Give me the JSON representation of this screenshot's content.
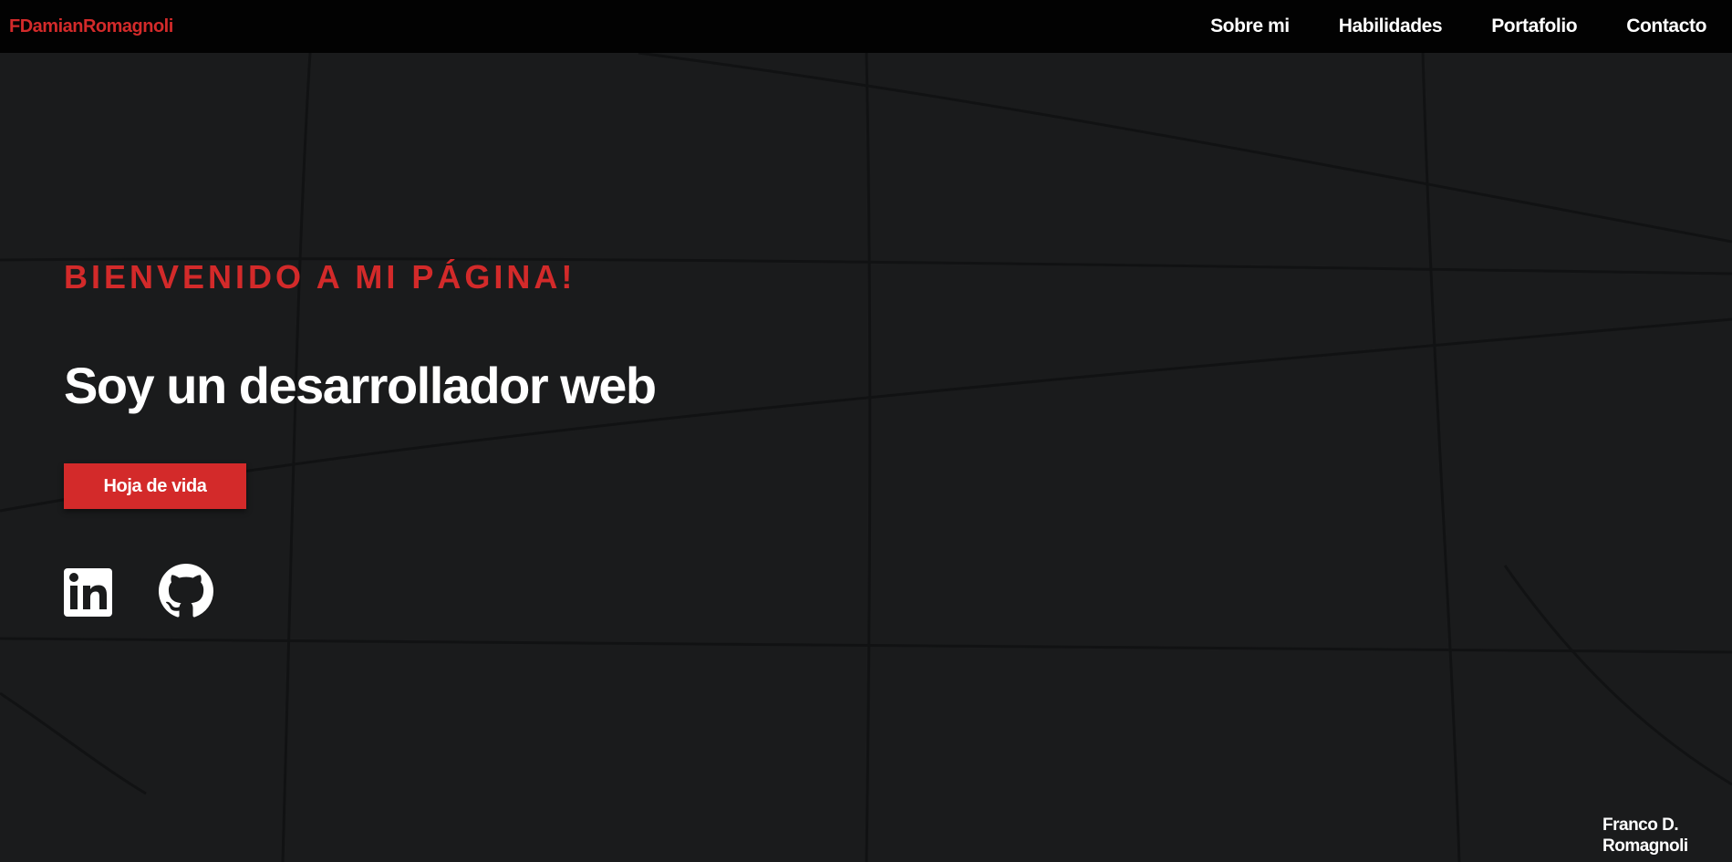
{
  "nav": {
    "brand": "FDamianRomagnoli",
    "links": [
      "Sobre mi",
      "Habilidades",
      "Portafolio",
      "Contacto"
    ]
  },
  "hero": {
    "welcome": "BIENVENIDO A MI PÁGINA!",
    "headline": "Soy un desarrollador web",
    "cv_button": "Hoja de vida",
    "socials": [
      {
        "icon": "linkedin-icon"
      },
      {
        "icon": "github-icon"
      }
    ]
  },
  "footer": {
    "name_line1": "Franco D.",
    "name_line2": "Romagnoli"
  },
  "colors": {
    "accent": "#d32a2a",
    "background": "#1a1b1c",
    "navbar": "#020202",
    "text": "#ffffff"
  }
}
